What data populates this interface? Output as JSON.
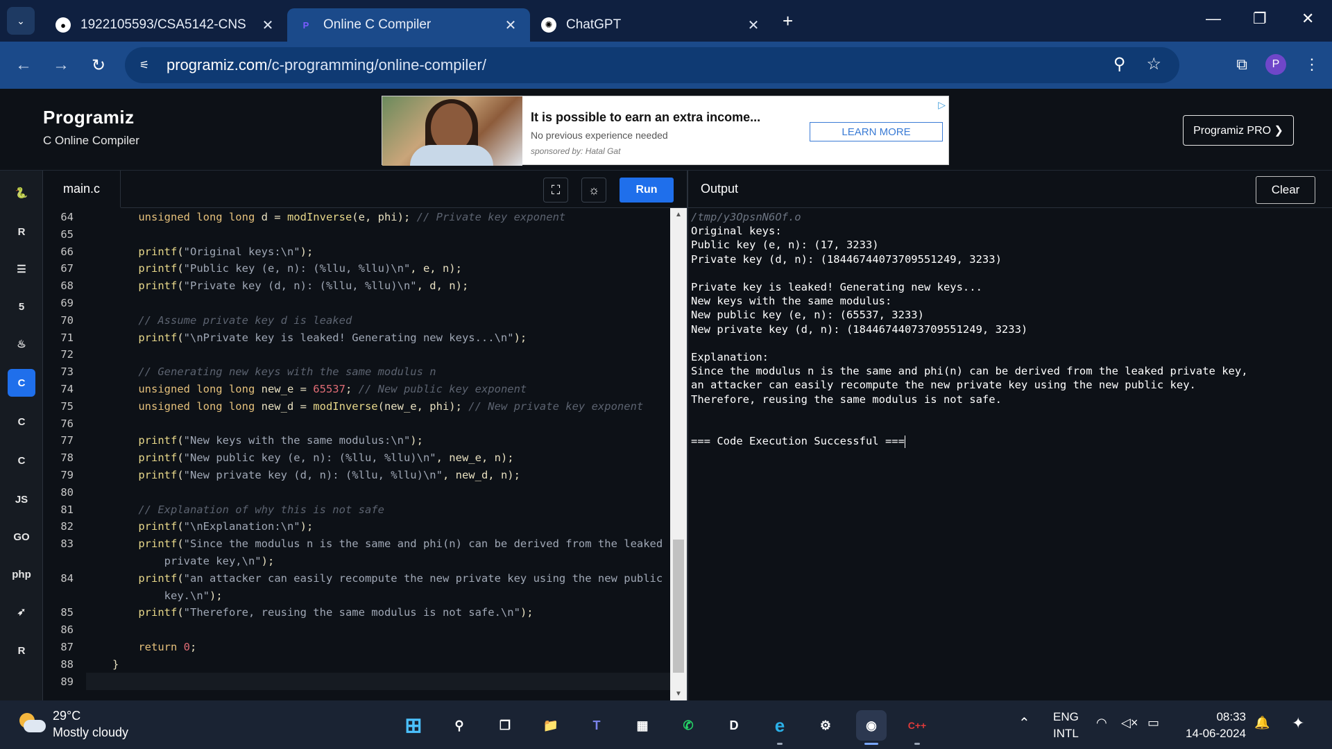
{
  "browser": {
    "tabs": [
      {
        "title": "1922105593/CSA5142-CNS",
        "icon": "github-icon",
        "active": false
      },
      {
        "title": "Online C Compiler",
        "icon": "programiz-icon",
        "active": true
      },
      {
        "title": "ChatGPT",
        "icon": "chatgpt-icon",
        "active": false
      }
    ],
    "url_host": "programiz.com",
    "url_path": "/c-programming/online-compiler/",
    "profile_initial": "P"
  },
  "site": {
    "logo": "Programiz",
    "subtitle": "C Online Compiler",
    "pro_button": "Programiz PRO ❯"
  },
  "ad": {
    "headline": "It is possible to earn an extra income...",
    "line2": "No previous experience needed",
    "line3": "sponsored by: Hatal Gat",
    "cta": "LEARN MORE"
  },
  "rail": {
    "languages": [
      {
        "name": "python-icon",
        "glyph": "🐍",
        "active": false
      },
      {
        "name": "r-icon",
        "glyph": "R",
        "active": false
      },
      {
        "name": "sql-icon",
        "glyph": "☰",
        "active": false
      },
      {
        "name": "html-icon",
        "glyph": "5",
        "active": false
      },
      {
        "name": "java-icon",
        "glyph": "♨",
        "active": false
      },
      {
        "name": "c-icon",
        "glyph": "C",
        "active": true
      },
      {
        "name": "cpp-icon",
        "glyph": "C",
        "active": false
      },
      {
        "name": "csharp-icon",
        "glyph": "C",
        "active": false
      },
      {
        "name": "js-icon",
        "glyph": "JS",
        "active": false
      },
      {
        "name": "go-icon",
        "glyph": "GO",
        "active": false
      },
      {
        "name": "php-icon",
        "glyph": "php",
        "active": false
      },
      {
        "name": "swift-icon",
        "glyph": "➶",
        "active": false
      },
      {
        "name": "rust-icon",
        "glyph": "R",
        "active": false
      }
    ]
  },
  "editor": {
    "file_tab": "main.c",
    "run_label": "Run",
    "lines": [
      {
        "n": "64",
        "tokens": [
          [
            "kw",
            "    unsigned long long "
          ],
          [
            "pl",
            "d = "
          ],
          [
            "fn",
            "modInverse"
          ],
          [
            "pl",
            "(e, phi); "
          ],
          [
            "cmt",
            "// Private key exponent"
          ]
        ]
      },
      {
        "n": "65",
        "tokens": []
      },
      {
        "n": "66",
        "tokens": [
          [
            "fn",
            "    printf"
          ],
          [
            "pl",
            "("
          ],
          [
            "str",
            "\"Original keys:\\n\""
          ],
          [
            "pl",
            ");"
          ]
        ]
      },
      {
        "n": "67",
        "tokens": [
          [
            "fn",
            "    printf"
          ],
          [
            "pl",
            "("
          ],
          [
            "str",
            "\"Public key (e, n): (%llu, %llu)\\n\""
          ],
          [
            "pl",
            ", e, n);"
          ]
        ]
      },
      {
        "n": "68",
        "tokens": [
          [
            "fn",
            "    printf"
          ],
          [
            "pl",
            "("
          ],
          [
            "str",
            "\"Private key (d, n): (%llu, %llu)\\n\""
          ],
          [
            "pl",
            ", d, n);"
          ]
        ]
      },
      {
        "n": "69",
        "tokens": []
      },
      {
        "n": "70",
        "tokens": [
          [
            "cmt",
            "    // Assume private key d is leaked"
          ]
        ]
      },
      {
        "n": "71",
        "tokens": [
          [
            "fn",
            "    printf"
          ],
          [
            "pl",
            "("
          ],
          [
            "str",
            "\"\\nPrivate key is leaked! Generating new keys...\\n\""
          ],
          [
            "pl",
            ");"
          ]
        ]
      },
      {
        "n": "72",
        "tokens": []
      },
      {
        "n": "73",
        "tokens": [
          [
            "cmt",
            "    // Generating new keys with the same modulus n"
          ]
        ]
      },
      {
        "n": "74",
        "tokens": [
          [
            "kw",
            "    unsigned long long "
          ],
          [
            "pl",
            "new_e = "
          ],
          [
            "num",
            "65537"
          ],
          [
            "pl",
            "; "
          ],
          [
            "cmt",
            "// New public key exponent"
          ]
        ]
      },
      {
        "n": "75",
        "tokens": [
          [
            "kw",
            "    unsigned long long "
          ],
          [
            "pl",
            "new_d = "
          ],
          [
            "fn",
            "modInverse"
          ],
          [
            "pl",
            "(new_e, phi); "
          ],
          [
            "cmt",
            "// New private key exponent"
          ]
        ]
      },
      {
        "n": "76",
        "tokens": []
      },
      {
        "n": "77",
        "tokens": [
          [
            "fn",
            "    printf"
          ],
          [
            "pl",
            "("
          ],
          [
            "str",
            "\"New keys with the same modulus:\\n\""
          ],
          [
            "pl",
            ");"
          ]
        ]
      },
      {
        "n": "78",
        "tokens": [
          [
            "fn",
            "    printf"
          ],
          [
            "pl",
            "("
          ],
          [
            "str",
            "\"New public key (e, n): (%llu, %llu)\\n\""
          ],
          [
            "pl",
            ", new_e, n);"
          ]
        ]
      },
      {
        "n": "79",
        "tokens": [
          [
            "fn",
            "    printf"
          ],
          [
            "pl",
            "("
          ],
          [
            "str",
            "\"New private key (d, n): (%llu, %llu)\\n\""
          ],
          [
            "pl",
            ", new_d, n);"
          ]
        ]
      },
      {
        "n": "80",
        "tokens": []
      },
      {
        "n": "81",
        "tokens": [
          [
            "cmt",
            "    // Explanation of why this is not safe"
          ]
        ]
      },
      {
        "n": "82",
        "tokens": [
          [
            "fn",
            "    printf"
          ],
          [
            "pl",
            "("
          ],
          [
            "str",
            "\"\\nExplanation:\\n\""
          ],
          [
            "pl",
            ");"
          ]
        ]
      },
      {
        "n": "83",
        "tokens": [
          [
            "fn",
            "    printf"
          ],
          [
            "pl",
            "("
          ],
          [
            "str",
            "\"Since the modulus n is the same and phi(n) can be derived from the leaked"
          ]
        ]
      },
      {
        "n": "",
        "tokens": [
          [
            "str",
            "        private key,\\n\""
          ],
          [
            "pl",
            ");"
          ]
        ]
      },
      {
        "n": "84",
        "tokens": [
          [
            "fn",
            "    printf"
          ],
          [
            "pl",
            "("
          ],
          [
            "str",
            "\"an attacker can easily recompute the new private key using the new public"
          ]
        ]
      },
      {
        "n": "",
        "tokens": [
          [
            "str",
            "        key.\\n\""
          ],
          [
            "pl",
            ");"
          ]
        ]
      },
      {
        "n": "85",
        "tokens": [
          [
            "fn",
            "    printf"
          ],
          [
            "pl",
            "("
          ],
          [
            "str",
            "\"Therefore, reusing the same modulus is not safe.\\n\""
          ],
          [
            "pl",
            ");"
          ]
        ]
      },
      {
        "n": "86",
        "tokens": []
      },
      {
        "n": "87",
        "tokens": [
          [
            "kw",
            "    return "
          ],
          [
            "num",
            "0"
          ],
          [
            "pl",
            ";"
          ]
        ]
      },
      {
        "n": "88",
        "tokens": [
          [
            "pl",
            "}"
          ]
        ]
      },
      {
        "n": "89",
        "tokens": []
      }
    ]
  },
  "output": {
    "title": "Output",
    "clear_label": "Clear",
    "lines": [
      {
        "text": "/tmp/y3OpsnN6Of.o",
        "path": true
      },
      {
        "text": "Original keys:"
      },
      {
        "text": "Public key (e, n): (17, 3233)"
      },
      {
        "text": "Private key (d, n): (18446744073709551249, 3233)"
      },
      {
        "text": ""
      },
      {
        "text": "Private key is leaked! Generating new keys..."
      },
      {
        "text": "New keys with the same modulus:"
      },
      {
        "text": "New public key (e, n): (65537, 3233)"
      },
      {
        "text": "New private key (d, n): (18446744073709551249, 3233)"
      },
      {
        "text": ""
      },
      {
        "text": "Explanation:"
      },
      {
        "text": "Since the modulus n is the same and phi(n) can be derived from the leaked private key,"
      },
      {
        "text": "an attacker can easily recompute the new private key using the new public key."
      },
      {
        "text": "Therefore, reusing the same modulus is not safe."
      },
      {
        "text": ""
      },
      {
        "text": ""
      },
      {
        "text": "=== Code Execution Successful ==="
      }
    ]
  },
  "taskbar": {
    "temperature": "29°C",
    "weather": "Mostly cloudy",
    "lang_line1": "ENG",
    "lang_line2": "INTL",
    "time": "08:33",
    "date": "14-06-2024",
    "apps": [
      {
        "name": "windows-start-icon",
        "glyph": "⊞",
        "active": false
      },
      {
        "name": "search-icon",
        "glyph": "⚲",
        "active": false
      },
      {
        "name": "task-view-icon",
        "glyph": "❐",
        "active": false
      },
      {
        "name": "file-explorer-icon",
        "glyph": "📁",
        "active": false
      },
      {
        "name": "teams-icon",
        "glyph": "T",
        "active": false
      },
      {
        "name": "microsoft-store-icon",
        "glyph": "▦",
        "active": false
      },
      {
        "name": "whatsapp-icon",
        "glyph": "✆",
        "active": false
      },
      {
        "name": "dell-icon",
        "glyph": "D",
        "active": false
      },
      {
        "name": "edge-icon",
        "glyph": "e",
        "active": false
      },
      {
        "name": "settings-app-icon",
        "glyph": "⚙",
        "active": false
      },
      {
        "name": "chrome-icon",
        "glyph": "◉",
        "active": true
      },
      {
        "name": "devcpp-icon",
        "glyph": "C++",
        "active": false
      }
    ]
  }
}
